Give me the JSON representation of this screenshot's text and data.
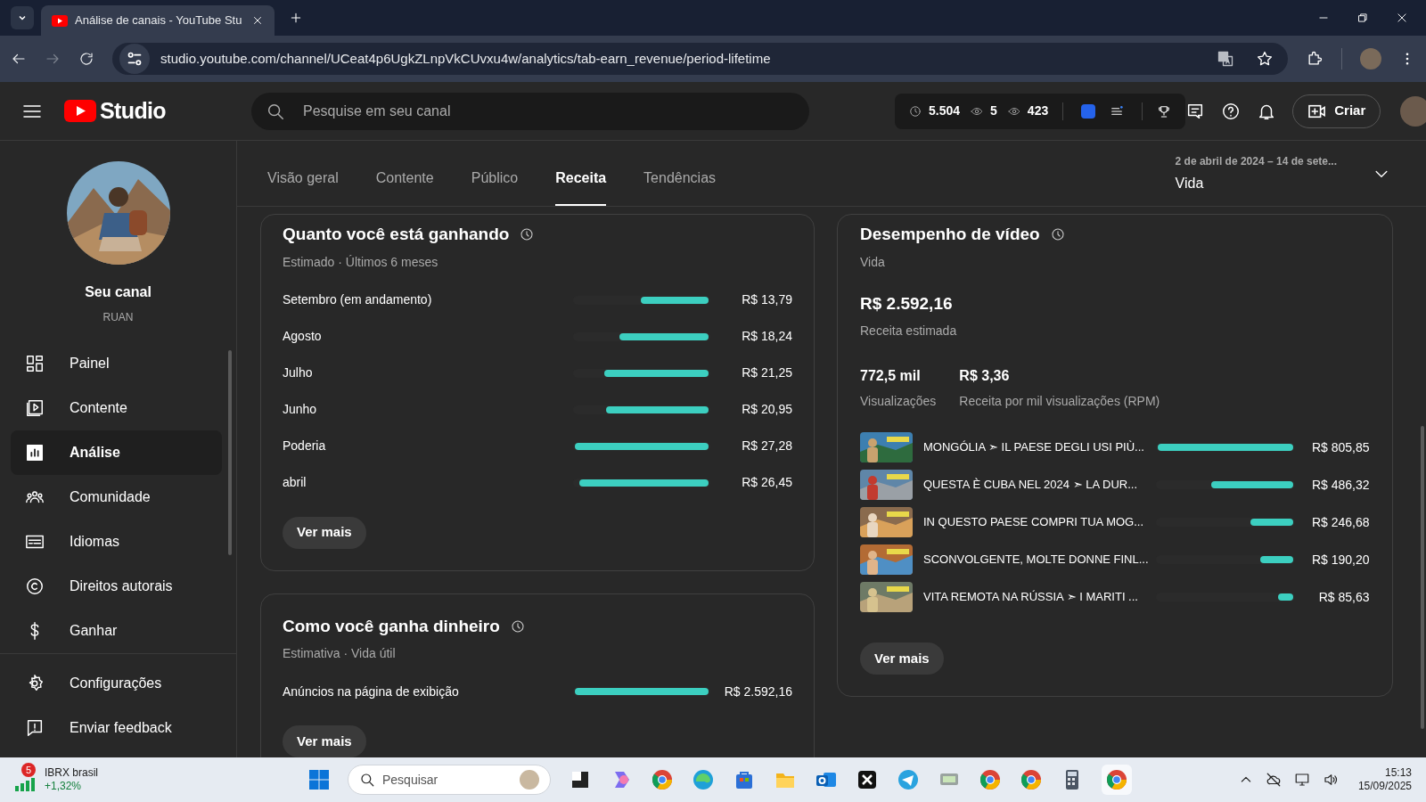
{
  "browser": {
    "tab_title": "Análise de canais - YouTube Stu",
    "url": "studio.youtube.com/channel/UCeat4p6UgkZLnpVkCUvxu4w/analytics/tab-earn_revenue/period-lifetime"
  },
  "header": {
    "logo": "Studio",
    "search": {
      "placeholder": "Pesquise em seu canal"
    },
    "stats": [
      "5.504",
      "5",
      "423"
    ],
    "create_button": "Criar"
  },
  "sidebar": {
    "channel_name": "Seu canal",
    "channel_handle": "RUAN",
    "items": [
      {
        "label": "Painel",
        "selected": false
      },
      {
        "label": "Contente",
        "selected": false
      },
      {
        "label": "Análise",
        "selected": true
      },
      {
        "label": "Comunidade",
        "selected": false
      },
      {
        "label": "Idiomas",
        "selected": false
      },
      {
        "label": "Direitos autorais",
        "selected": false
      },
      {
        "label": "Ganhar",
        "selected": false
      }
    ],
    "bottom_items": [
      "Configurações",
      "Enviar feedback"
    ]
  },
  "tabs": [
    {
      "label": "Visão geral",
      "selected": false
    },
    {
      "label": "Contente",
      "selected": false
    },
    {
      "label": "Público",
      "selected": false
    },
    {
      "label": "Receita",
      "selected": true
    },
    {
      "label": "Tendências",
      "selected": false
    }
  ],
  "period": {
    "range": "2 de abril de 2024 – 14 de sete...",
    "label": "Vida"
  },
  "earnings_card": {
    "title": "Quanto você está ganhando",
    "subtitle": "Estimado · Últimos 6 meses",
    "rows": [
      {
        "label": "Setembro (em andamento)",
        "level": 0.505,
        "value": "R$ 13,79"
      },
      {
        "label": "Agosto",
        "level": 0.669,
        "value": "R$ 18,24"
      },
      {
        "label": "Julho",
        "level": 0.779,
        "value": "R$ 21,25"
      },
      {
        "label": "Junho",
        "level": 0.768,
        "value": "R$ 20,95"
      },
      {
        "label": "Poderia",
        "level": 1,
        "value": "R$ 27,28"
      },
      {
        "label": "abril",
        "level": 0.97,
        "value": "R$ 26,45"
      }
    ],
    "button": "Ver mais"
  },
  "sources_card": {
    "title": "Como você ganha dinheiro",
    "subtitle": "Estimativa · Vida útil",
    "rows": [
      {
        "label": "Anúncios na página de exibição",
        "level": 1,
        "value": "R$ 2.592,16"
      }
    ],
    "button": "Ver mais"
  },
  "video_card": {
    "title": "Desempenho de vídeo",
    "subtitle": "Vida",
    "total": "R$ 2.592,16",
    "total_label": "Receita estimada",
    "metrics": [
      {
        "value": "772,5 mil",
        "label": "Visualizações"
      },
      {
        "value": "R$ 3,36",
        "label": "Receita por mil visualizações (RPM)"
      }
    ],
    "videos": [
      {
        "title": "MONGÓLIA ➣ IL PAESE DEGLI USI PIÙ...",
        "level": 1,
        "value": "R$ 805,85"
      },
      {
        "title": "QUESTA È CUBA NEL 2024 ➣ LA DUR...",
        "level": 0.6,
        "value": "R$ 486,32"
      },
      {
        "title": "IN QUESTO PAESE COMPRI TUA MOG...",
        "level": 0.31,
        "value": "R$ 246,68"
      },
      {
        "title": "SCONVOLGENTE, MOLTE DONNE FINL...",
        "level": 0.24,
        "value": "R$ 190,20"
      },
      {
        "title": "VITA REMOTA NA RÚSSIA ➣ I MARITI ...",
        "level": 0.11,
        "value": "R$ 85,63"
      }
    ],
    "button": "Ver mais"
  },
  "taskbar": {
    "widget_badge": "5",
    "widget_title": "IBRX brasil",
    "widget_change": "+1,32%",
    "search_placeholder": "Pesquisar",
    "time": "15:13",
    "date": "15/09/2025"
  }
}
